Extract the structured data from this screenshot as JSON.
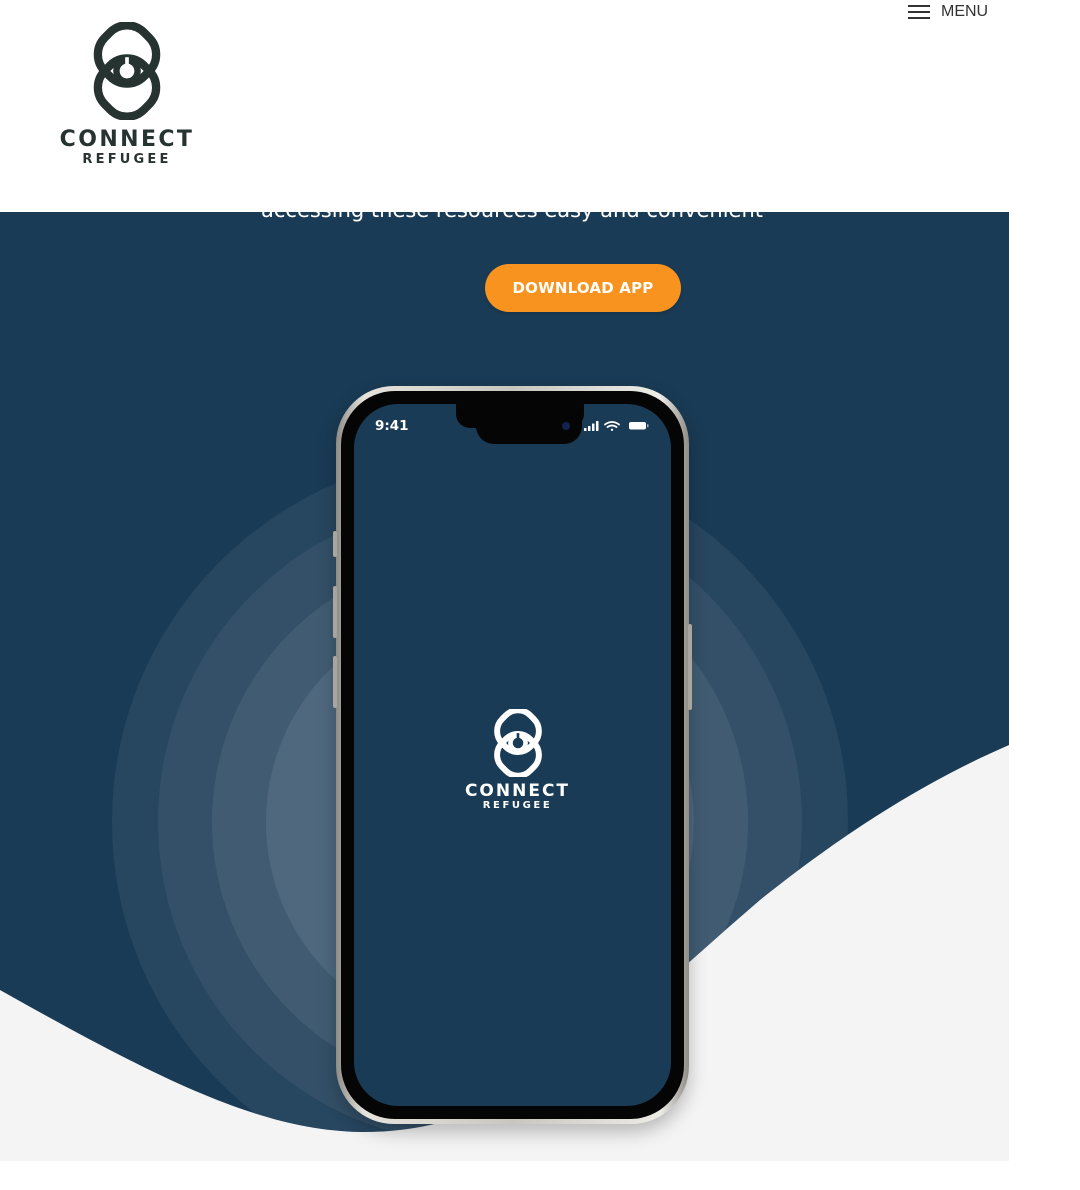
{
  "header": {
    "logo": {
      "wordmark": "CONNECT",
      "subtitle": "REFUGEE",
      "icon": "connect-refugee-logo-icon"
    },
    "menu": {
      "label": "MENU",
      "icon": "hamburger-icon"
    }
  },
  "hero": {
    "tagline": "accessing these resources easy and convenient",
    "cta_label": "DOWNLOAD APP"
  },
  "phone": {
    "status_time": "9:41",
    "status_icons": [
      "signal-icon",
      "wifi-icon",
      "battery-icon"
    ],
    "splash": {
      "wordmark": "CONNECT",
      "subtitle": "REFUGEE"
    }
  },
  "colors": {
    "hero_background": "#1a3b55",
    "cta": "#f7931e",
    "logo_dark": "#273331",
    "wave_light": "#f4f4f4"
  }
}
